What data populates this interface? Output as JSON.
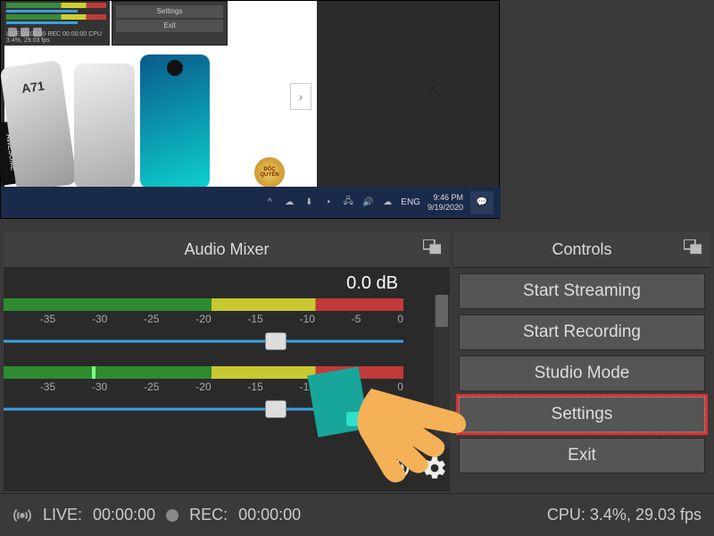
{
  "preview": {
    "mini_controls": {
      "settings": "Settings",
      "exit": "Exit"
    },
    "mini_status": "LIVE 00:00:00  REC 00:00:00  CPU 3.4%, 29.03 fps",
    "phone_label": "A71",
    "awesome": "AWESOME",
    "badge": "ĐỘC QUYỀN",
    "taskbar": {
      "lang": "ENG",
      "time": "9:46 PM",
      "date": "9/19/2020"
    }
  },
  "mixer": {
    "title": "Audio Mixer",
    "db": "0.0 dB",
    "ticks": [
      "",
      "-35",
      "-30",
      "-25",
      "-20",
      "-15",
      "-10",
      "-5",
      "0"
    ]
  },
  "controls": {
    "title": "Controls",
    "buttons": {
      "start_streaming": "Start Streaming",
      "start_recording": "Start Recording",
      "studio_mode": "Studio Mode",
      "settings": "Settings",
      "exit": "Exit"
    }
  },
  "status": {
    "live_label": "LIVE:",
    "live_time": "00:00:00",
    "rec_label": "REC:",
    "rec_time": "00:00:00",
    "cpu": "CPU: 3.4%, 29.03 fps"
  }
}
